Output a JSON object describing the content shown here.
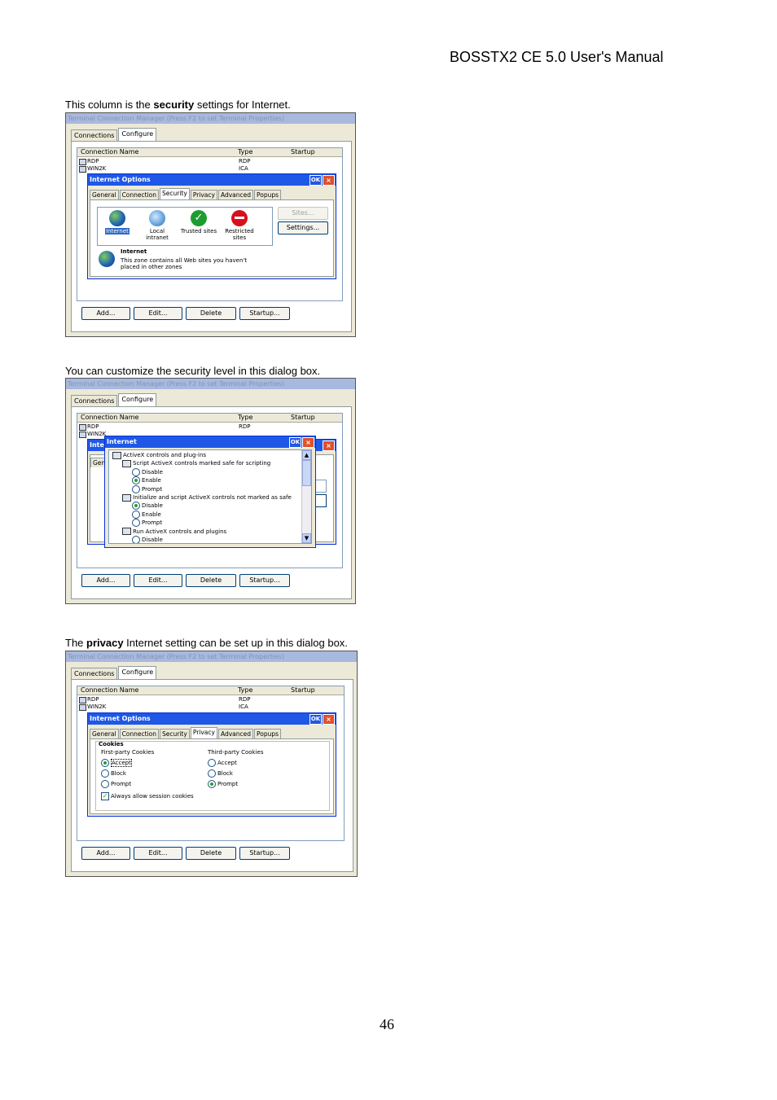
{
  "header": {
    "manual_title": "BOSSTX2 CE 5.0 User's Manual"
  },
  "page_number": "46",
  "captions": {
    "c1_pre": "This column is the ",
    "c1_bold": "security",
    "c1_post": " settings for Internet.",
    "c2": "You can customize the security level in this dialog box.",
    "c3_pre": "The ",
    "c3_bold": "privacy",
    "c3_post": " Internet setting can be set up in this dialog box."
  },
  "app": {
    "window_title": "Terminal Connection Manager (Press F2 to set Terminal Properties)",
    "tabs": [
      "Connections",
      "Configure"
    ],
    "columns": [
      "Connection Name",
      "Type",
      "Startup"
    ],
    "rows": [
      {
        "name": "RDP",
        "type": "RDP"
      },
      {
        "name": "WIN2K",
        "type": "ICA"
      }
    ],
    "buttons": [
      "Add...",
      "Edit...",
      "Delete",
      "Startup..."
    ]
  },
  "internet_options": {
    "title": "Internet Options",
    "ok": "OK",
    "close": "×",
    "tabs": [
      "General",
      "Connection",
      "Security",
      "Privacy",
      "Advanced",
      "Popups"
    ],
    "security": {
      "zones": [
        "Internet",
        "Local intranet",
        "Trusted sites",
        "Restricted sites"
      ],
      "sites_button": "Sites...",
      "settings_button": "Settings...",
      "zone_title": "Internet",
      "zone_desc_1": "This zone contains all Web sites you haven't",
      "zone_desc_2": "placed in other zones"
    },
    "privacy": {
      "group": "Cookies",
      "first_party": "First-party Cookies",
      "third_party": "Third-party Cookies",
      "options": [
        "Accept",
        "Block",
        "Prompt"
      ],
      "first_selected": "Accept",
      "third_selected": "Prompt",
      "session_cookies": "Always allow session cookies"
    }
  },
  "internet_settings": {
    "title": "Internet",
    "ok": "OK",
    "close": "×",
    "behind_partial_title": "Inte",
    "behind_partial_tab": "Gene",
    "tree": [
      {
        "text": "ActiveX controls and plug-ins",
        "kind": "group"
      },
      {
        "text": "Script ActiveX controls marked safe for scripting",
        "kind": "group"
      },
      {
        "text": "Disable",
        "kind": "radio",
        "on": false
      },
      {
        "text": "Enable",
        "kind": "radio",
        "on": true
      },
      {
        "text": "Prompt",
        "kind": "radio",
        "on": false
      },
      {
        "text": "Initialize and script ActiveX controls not marked as safe",
        "kind": "group"
      },
      {
        "text": "Disable",
        "kind": "radio",
        "on": true
      },
      {
        "text": "Enable",
        "kind": "radio",
        "on": false
      },
      {
        "text": "Prompt",
        "kind": "radio",
        "on": false
      },
      {
        "text": "Run ActiveX controls and plugins",
        "kind": "group"
      },
      {
        "text": "Disable",
        "kind": "radio",
        "on": false
      }
    ]
  }
}
